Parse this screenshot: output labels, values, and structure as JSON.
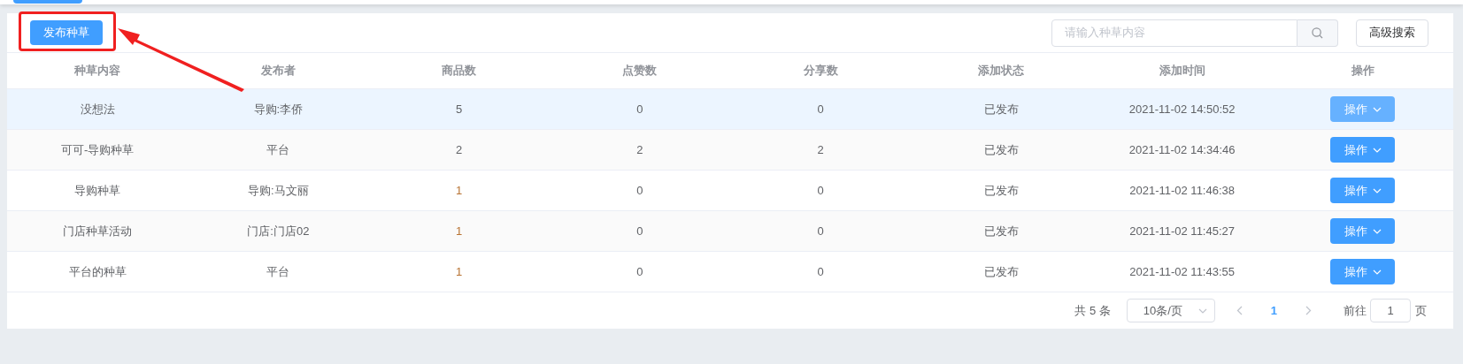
{
  "toolbar": {
    "publish_button": "发布种草",
    "search": {
      "placeholder": "请输入种草内容"
    },
    "advanced_button": "高级搜索"
  },
  "table": {
    "columns": [
      "种草内容",
      "发布者",
      "商品数",
      "点赞数",
      "分享数",
      "添加状态",
      "添加时间",
      "操作"
    ],
    "rows": [
      {
        "selected": true,
        "content": "没想法",
        "publisher": "导购:李侨",
        "goods": "5",
        "goods_highlighted": false,
        "likes": "0",
        "shares": "0",
        "status": "已发布",
        "time": "2021-11-02 14:50:52",
        "action": "操作"
      },
      {
        "selected": false,
        "content": "可可-导购种草",
        "publisher": "平台",
        "goods": "2",
        "goods_highlighted": false,
        "likes": "2",
        "shares": "2",
        "status": "已发布",
        "time": "2021-11-02 14:34:46",
        "action": "操作"
      },
      {
        "selected": false,
        "content": "导购种草",
        "publisher": "导购:马文丽",
        "goods": "1",
        "goods_highlighted": true,
        "likes": "0",
        "shares": "0",
        "status": "已发布",
        "time": "2021-11-02 11:46:38",
        "action": "操作"
      },
      {
        "selected": false,
        "content": "门店种草活动",
        "publisher": "门店:门店02",
        "goods": "1",
        "goods_highlighted": true,
        "likes": "0",
        "shares": "0",
        "status": "已发布",
        "time": "2021-11-02 11:45:27",
        "action": "操作"
      },
      {
        "selected": false,
        "content": "平台的种草",
        "publisher": "平台",
        "goods": "1",
        "goods_highlighted": true,
        "likes": "0",
        "shares": "0",
        "status": "已发布",
        "time": "2021-11-02 11:43:55",
        "action": "操作"
      }
    ]
  },
  "pagination": {
    "total": "共 5 条",
    "page_size": "10条/页",
    "pages": [
      {
        "label": "1",
        "selected": true
      }
    ],
    "goto_label": "前往",
    "goto_value": "1",
    "goto_suffix": "页"
  }
}
